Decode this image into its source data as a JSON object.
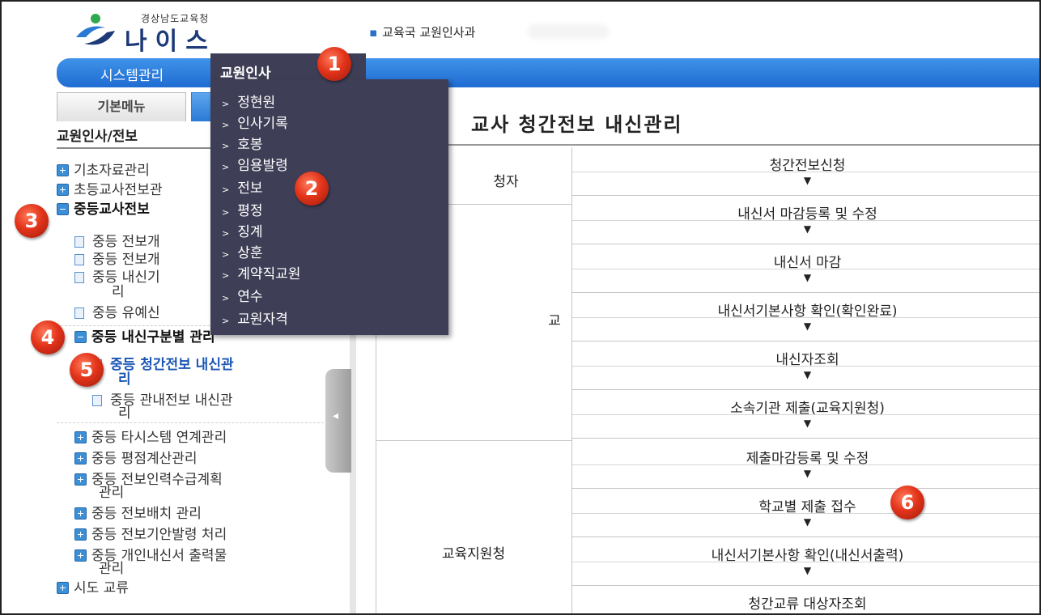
{
  "header": {
    "org_name": "경상남도교육청",
    "app_name": "나이스",
    "dept_dot": "▪",
    "dept": "교육국 교원인사과"
  },
  "topnav": {
    "items": [
      "시스템관리",
      "교원인사"
    ],
    "active_index": 1
  },
  "tabs": {
    "items": [
      "기본메뉴",
      ""
    ]
  },
  "sidebar": {
    "title": "교원인사/전보",
    "items": [
      {
        "label": "기초자료관리",
        "type": "plus"
      },
      {
        "label": "초등교사전보관",
        "type": "plus"
      },
      {
        "label": "중등교사전보",
        "type": "minus",
        "bold": true
      },
      {
        "label": "중등 전보개",
        "type": "doc"
      },
      {
        "label": "중등 전보개",
        "type": "doc"
      },
      {
        "label": "중등 내신기",
        "type": "doc"
      },
      {
        "label": "리",
        "type": "wrap"
      },
      {
        "label": "중등 유예신",
        "type": "doc"
      },
      {
        "label": "중등 내신구분별 관리",
        "type": "minus",
        "bold": true
      },
      {
        "label": "중등 청간전보 내신관",
        "type": "doc",
        "selected": true
      },
      {
        "label": "리",
        "type": "wrap"
      },
      {
        "label": "중등 관내전보 내신관",
        "type": "doc"
      },
      {
        "label": "리",
        "type": "wrap"
      },
      {
        "label": "중등 타시스템 연계관리",
        "type": "plus"
      },
      {
        "label": "중등 평점계산관리",
        "type": "plus"
      },
      {
        "label": "중등 전보인력수급계획",
        "type": "plus"
      },
      {
        "label": "관리",
        "type": "wrap"
      },
      {
        "label": "중등 전보배치 관리",
        "type": "plus"
      },
      {
        "label": "중등 전보기안발령 처리",
        "type": "plus"
      },
      {
        "label": "중등 개인내신서 출력물",
        "type": "plus"
      },
      {
        "label": "관리",
        "type": "wrap"
      },
      {
        "label": "시도 교류",
        "type": "plus"
      }
    ]
  },
  "dropdown": {
    "chevron": ">",
    "items": [
      "정현원",
      "인사기록",
      "호봉",
      "임용발령",
      "전보",
      "평정",
      "징계",
      "상훈",
      "계약직교원",
      "연수",
      "교원자격"
    ]
  },
  "content": {
    "title": "교사 청간전보 내신관리",
    "roles": [
      "청자",
      "교",
      "교육지원청"
    ],
    "arrow": "▼",
    "steps": [
      "청간전보신청",
      "내신서 마감등록 및 수정",
      "내신서 마감",
      "내신서기본사항 확인(확인완료)",
      "내신자조회",
      "소속기관 제출(교육지원청)",
      "제출마감등록 및 수정",
      "학교별 제출 접수",
      "내신서기본사항 확인(내신서출력)",
      "청간교류 대상자조회"
    ]
  },
  "handle_arrow": "◂",
  "badges": [
    "1",
    "2",
    "3",
    "4",
    "5",
    "6"
  ],
  "colors": {
    "nav_blue": "#1f6cd2",
    "dropdown_bg": "#3e3e56",
    "badge_red": "#e3341b",
    "selected_text": "#1b56b5"
  }
}
